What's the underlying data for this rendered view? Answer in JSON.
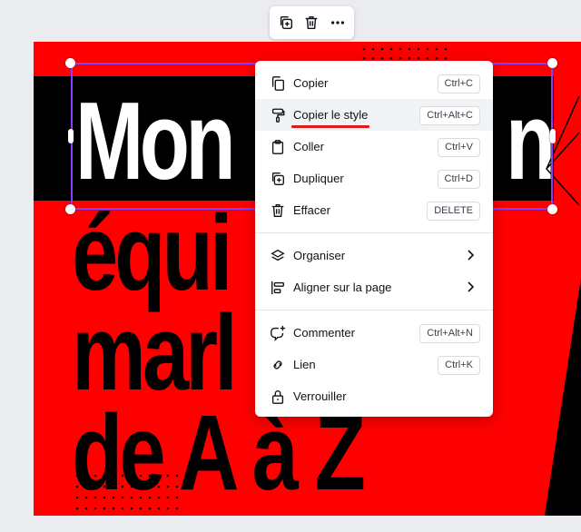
{
  "toolbar": {
    "buttons": [
      {
        "icon": "duplicate-add-icon"
      },
      {
        "icon": "trash-icon"
      },
      {
        "icon": "more-icon"
      }
    ]
  },
  "canvas": {
    "title": "Mon",
    "title_right": "n",
    "lines": [
      "équi",
      "marl",
      "de A à Z"
    ],
    "colors": {
      "background": "#fe0000",
      "band": "#000000",
      "title": "#ffffff",
      "selection": "#8b3dff"
    }
  },
  "menu": {
    "groups": [
      [
        {
          "label": "Copier",
          "shortcut": "Ctrl+C",
          "icon": "copy-icon"
        },
        {
          "label": "Copier le style",
          "shortcut": "Ctrl+Alt+C",
          "icon": "paint-roller-icon",
          "highlighted": true
        },
        {
          "label": "Coller",
          "shortcut": "Ctrl+V",
          "icon": "clipboard-icon"
        },
        {
          "label": "Dupliquer",
          "shortcut": "Ctrl+D",
          "icon": "duplicate-icon"
        },
        {
          "label": "Effacer",
          "shortcut": "DELETE",
          "icon": "trash-icon"
        }
      ],
      [
        {
          "label": "Organiser",
          "icon": "layers-icon",
          "submenu": true
        },
        {
          "label": "Aligner sur la page",
          "icon": "align-icon",
          "submenu": true
        }
      ],
      [
        {
          "label": "Commenter",
          "shortcut": "Ctrl+Alt+N",
          "icon": "comment-add-icon"
        },
        {
          "label": "Lien",
          "shortcut": "Ctrl+K",
          "icon": "link-icon"
        },
        {
          "label": "Verrouiller",
          "icon": "lock-icon"
        }
      ]
    ]
  }
}
